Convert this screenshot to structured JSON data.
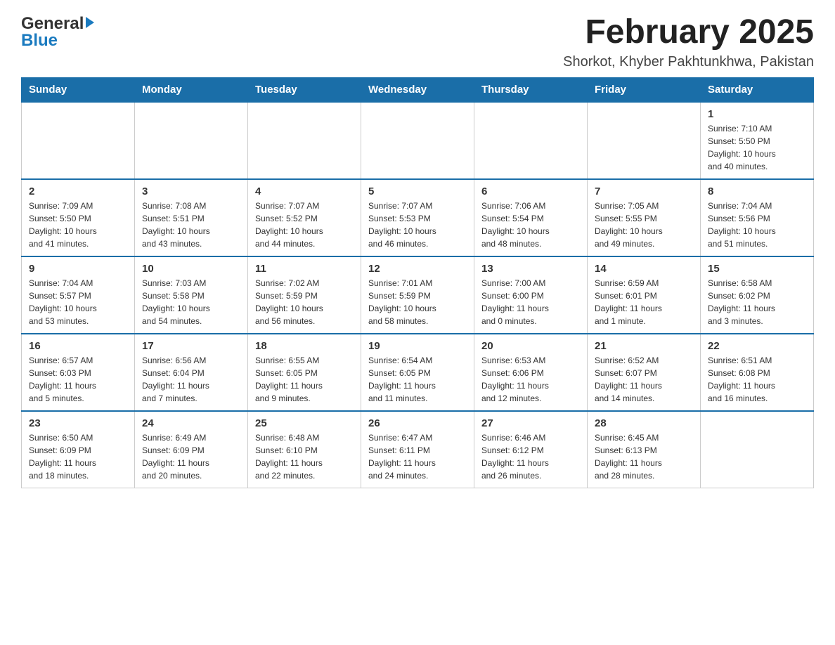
{
  "header": {
    "logo_general": "General",
    "logo_blue": "Blue",
    "title": "February 2025",
    "subtitle": "Shorkot, Khyber Pakhtunkhwa, Pakistan"
  },
  "weekdays": [
    "Sunday",
    "Monday",
    "Tuesday",
    "Wednesday",
    "Thursday",
    "Friday",
    "Saturday"
  ],
  "weeks": [
    [
      {
        "day": "",
        "info": ""
      },
      {
        "day": "",
        "info": ""
      },
      {
        "day": "",
        "info": ""
      },
      {
        "day": "",
        "info": ""
      },
      {
        "day": "",
        "info": ""
      },
      {
        "day": "",
        "info": ""
      },
      {
        "day": "1",
        "info": "Sunrise: 7:10 AM\nSunset: 5:50 PM\nDaylight: 10 hours\nand 40 minutes."
      }
    ],
    [
      {
        "day": "2",
        "info": "Sunrise: 7:09 AM\nSunset: 5:50 PM\nDaylight: 10 hours\nand 41 minutes."
      },
      {
        "day": "3",
        "info": "Sunrise: 7:08 AM\nSunset: 5:51 PM\nDaylight: 10 hours\nand 43 minutes."
      },
      {
        "day": "4",
        "info": "Sunrise: 7:07 AM\nSunset: 5:52 PM\nDaylight: 10 hours\nand 44 minutes."
      },
      {
        "day": "5",
        "info": "Sunrise: 7:07 AM\nSunset: 5:53 PM\nDaylight: 10 hours\nand 46 minutes."
      },
      {
        "day": "6",
        "info": "Sunrise: 7:06 AM\nSunset: 5:54 PM\nDaylight: 10 hours\nand 48 minutes."
      },
      {
        "day": "7",
        "info": "Sunrise: 7:05 AM\nSunset: 5:55 PM\nDaylight: 10 hours\nand 49 minutes."
      },
      {
        "day": "8",
        "info": "Sunrise: 7:04 AM\nSunset: 5:56 PM\nDaylight: 10 hours\nand 51 minutes."
      }
    ],
    [
      {
        "day": "9",
        "info": "Sunrise: 7:04 AM\nSunset: 5:57 PM\nDaylight: 10 hours\nand 53 minutes."
      },
      {
        "day": "10",
        "info": "Sunrise: 7:03 AM\nSunset: 5:58 PM\nDaylight: 10 hours\nand 54 minutes."
      },
      {
        "day": "11",
        "info": "Sunrise: 7:02 AM\nSunset: 5:59 PM\nDaylight: 10 hours\nand 56 minutes."
      },
      {
        "day": "12",
        "info": "Sunrise: 7:01 AM\nSunset: 5:59 PM\nDaylight: 10 hours\nand 58 minutes."
      },
      {
        "day": "13",
        "info": "Sunrise: 7:00 AM\nSunset: 6:00 PM\nDaylight: 11 hours\nand 0 minutes."
      },
      {
        "day": "14",
        "info": "Sunrise: 6:59 AM\nSunset: 6:01 PM\nDaylight: 11 hours\nand 1 minute."
      },
      {
        "day": "15",
        "info": "Sunrise: 6:58 AM\nSunset: 6:02 PM\nDaylight: 11 hours\nand 3 minutes."
      }
    ],
    [
      {
        "day": "16",
        "info": "Sunrise: 6:57 AM\nSunset: 6:03 PM\nDaylight: 11 hours\nand 5 minutes."
      },
      {
        "day": "17",
        "info": "Sunrise: 6:56 AM\nSunset: 6:04 PM\nDaylight: 11 hours\nand 7 minutes."
      },
      {
        "day": "18",
        "info": "Sunrise: 6:55 AM\nSunset: 6:05 PM\nDaylight: 11 hours\nand 9 minutes."
      },
      {
        "day": "19",
        "info": "Sunrise: 6:54 AM\nSunset: 6:05 PM\nDaylight: 11 hours\nand 11 minutes."
      },
      {
        "day": "20",
        "info": "Sunrise: 6:53 AM\nSunset: 6:06 PM\nDaylight: 11 hours\nand 12 minutes."
      },
      {
        "day": "21",
        "info": "Sunrise: 6:52 AM\nSunset: 6:07 PM\nDaylight: 11 hours\nand 14 minutes."
      },
      {
        "day": "22",
        "info": "Sunrise: 6:51 AM\nSunset: 6:08 PM\nDaylight: 11 hours\nand 16 minutes."
      }
    ],
    [
      {
        "day": "23",
        "info": "Sunrise: 6:50 AM\nSunset: 6:09 PM\nDaylight: 11 hours\nand 18 minutes."
      },
      {
        "day": "24",
        "info": "Sunrise: 6:49 AM\nSunset: 6:09 PM\nDaylight: 11 hours\nand 20 minutes."
      },
      {
        "day": "25",
        "info": "Sunrise: 6:48 AM\nSunset: 6:10 PM\nDaylight: 11 hours\nand 22 minutes."
      },
      {
        "day": "26",
        "info": "Sunrise: 6:47 AM\nSunset: 6:11 PM\nDaylight: 11 hours\nand 24 minutes."
      },
      {
        "day": "27",
        "info": "Sunrise: 6:46 AM\nSunset: 6:12 PM\nDaylight: 11 hours\nand 26 minutes."
      },
      {
        "day": "28",
        "info": "Sunrise: 6:45 AM\nSunset: 6:13 PM\nDaylight: 11 hours\nand 28 minutes."
      },
      {
        "day": "",
        "info": ""
      }
    ]
  ]
}
